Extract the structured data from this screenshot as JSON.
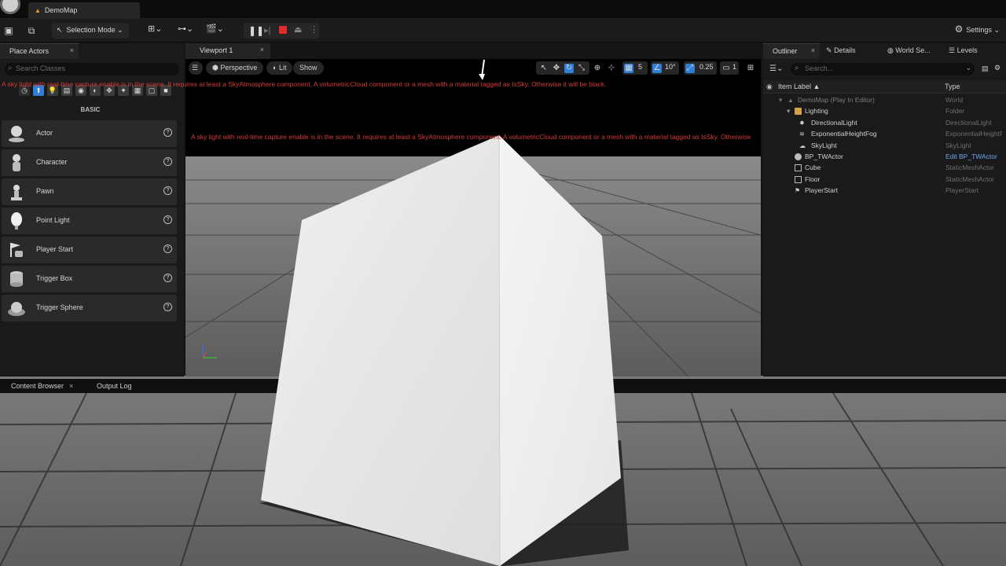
{
  "window": {
    "doc_tab": "DemoMap"
  },
  "toolbar": {
    "selection_mode": "Selection Mode",
    "settings": "Settings"
  },
  "place_actors": {
    "tab": "Place Actors",
    "search_placeholder": "Search Classes",
    "category": "BASIC",
    "items": [
      {
        "label": "Actor"
      },
      {
        "label": "Character"
      },
      {
        "label": "Pawn"
      },
      {
        "label": "Point Light"
      },
      {
        "label": "Player Start"
      },
      {
        "label": "Trigger Box"
      },
      {
        "label": "Trigger Sphere"
      }
    ]
  },
  "viewport": {
    "tab": "Viewport 1",
    "perspective": "Perspective",
    "lit": "Lit",
    "show": "Show",
    "grid_snap": "5",
    "rot_snap": "10°",
    "scale_snap": "0.25",
    "camera_speed": "1",
    "error_message": "A sky light with real-time capture enable is in the scene. It requires at least a SkyAtmosphere component, A volumetricCloud component or a mesh with a material tagged as IsSky. Otherwise it will be black.",
    "error_message_2": "A sky light with real-time capture enable is in the scene. It requires at least a SkyAtmosphere component, A volumetricCloud component or a mesh with a material tagged as IsSky. Otherwise"
  },
  "outliner": {
    "tabs": [
      "Outliner",
      "Details",
      "World Se...",
      "Levels"
    ],
    "search_placeholder": "Search...",
    "col_label": "Item Label ▲",
    "col_type": "Type",
    "rows": [
      {
        "name": "DemoMap (Play In Editor)",
        "type": "World"
      },
      {
        "name": "Lighting",
        "type": "Folder"
      },
      {
        "name": "DirectionalLight",
        "type": "DirectionalLight"
      },
      {
        "name": "ExponentialHeightFog",
        "type": "ExponentialHeightFog"
      },
      {
        "name": "SkyLight",
        "type": "SkyLight"
      },
      {
        "name": "BP_TWActor",
        "type": "Edit BP_TWActor"
      },
      {
        "name": "Cube",
        "type": "StaticMeshActor"
      },
      {
        "name": "Floor",
        "type": "StaticMeshActor"
      },
      {
        "name": "PlayerStart",
        "type": "PlayerStart"
      }
    ]
  },
  "bottom": {
    "content_browser": "Content Browser",
    "output_log": "Output Log"
  },
  "colors": {
    "error": "#d23a3a",
    "accent": "#2f7fd6",
    "folder": "#d2a24a"
  }
}
